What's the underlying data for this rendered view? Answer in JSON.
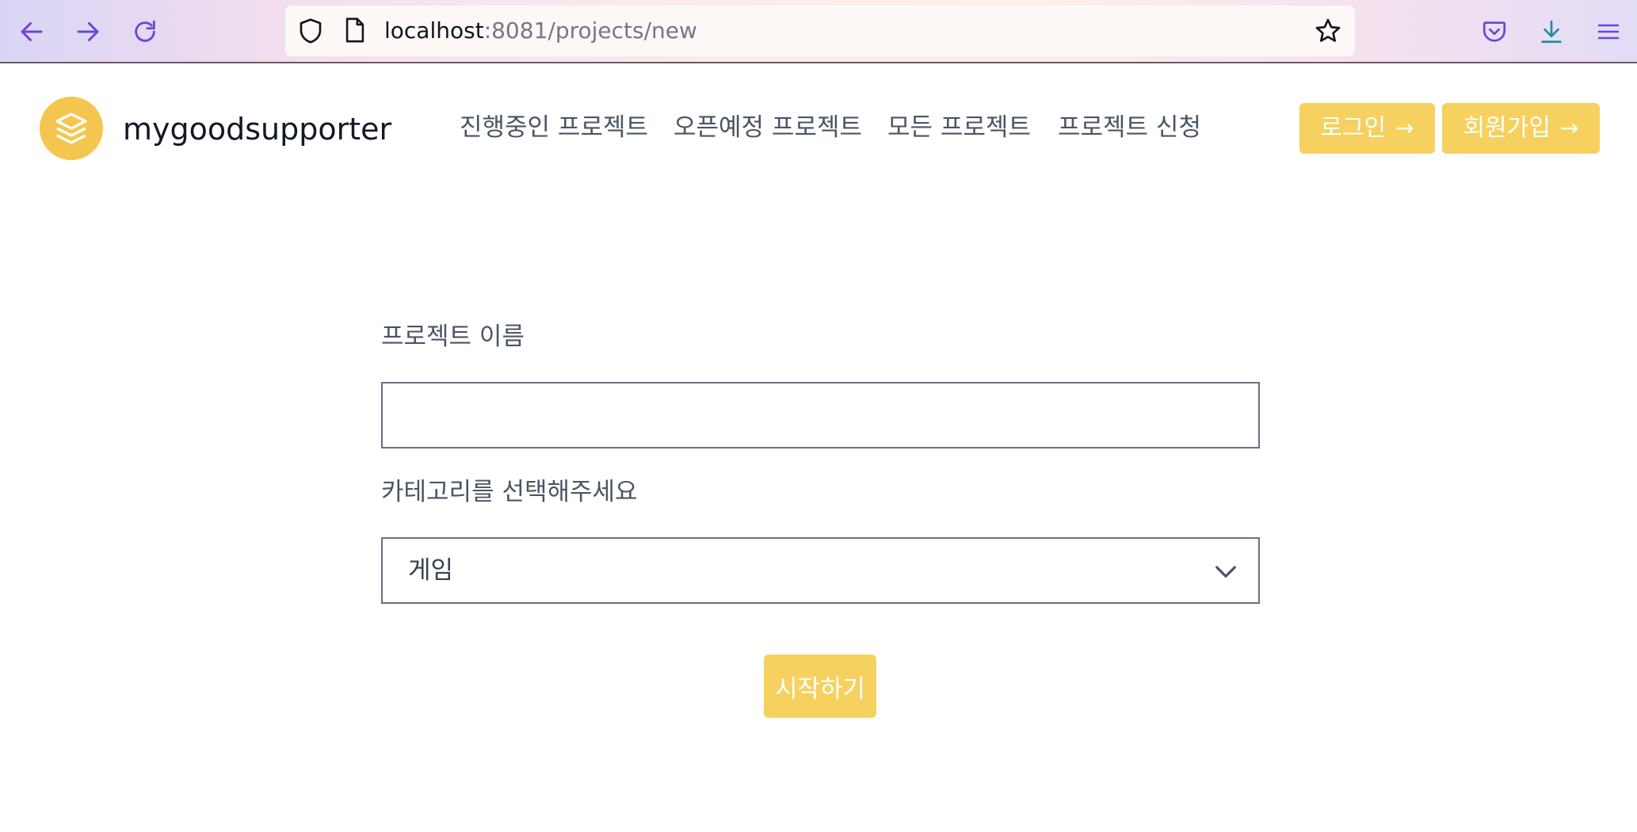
{
  "browser": {
    "url_host": "localhost",
    "url_path": ":8081/projects/new",
    "icons": [
      "back-arrow-icon",
      "forward-arrow-icon",
      "reload-icon",
      "shield-icon",
      "page-icon",
      "star-icon",
      "pocket-icon",
      "download-icon",
      "menu-icon"
    ]
  },
  "header": {
    "brand": "mygoodsupporter",
    "nav": [
      {
        "label": "진행중인 프로젝트"
      },
      {
        "label": "오픈예정 프로젝트"
      },
      {
        "label": "모든 프로젝트"
      },
      {
        "label": "프로젝트 신청"
      }
    ],
    "login_label": "로그인",
    "signup_label": "회원가입",
    "button_arrow": "→",
    "accent_color": "#f6d160",
    "logo_color": "#f4c64f"
  },
  "form": {
    "name_label": "프로젝트 이름",
    "name_value": "",
    "category_label": "카테고리를 선택해주세요",
    "category_selected": "게임",
    "submit_label": "시작하기"
  }
}
